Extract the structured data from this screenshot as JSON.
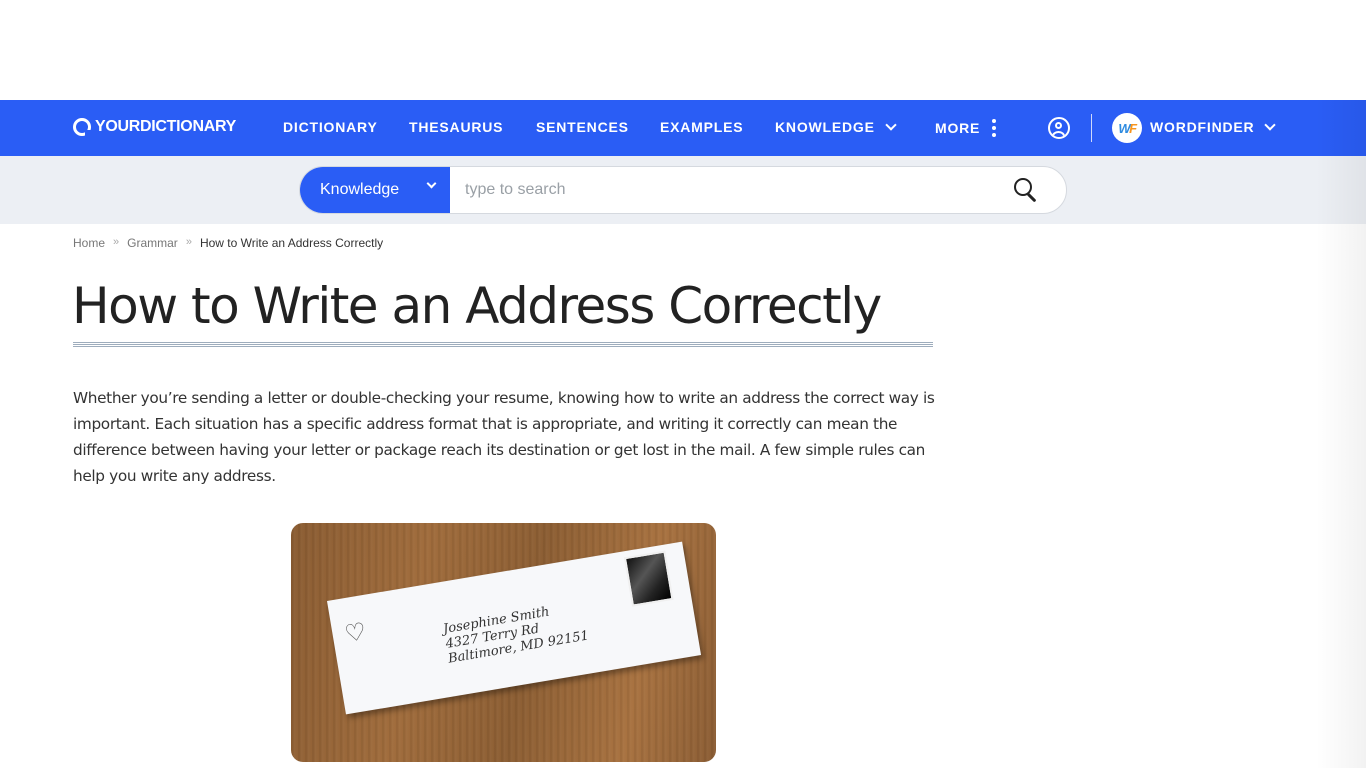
{
  "header": {
    "logo": "YOURDICTIONARY",
    "nav": [
      {
        "label": "DICTIONARY"
      },
      {
        "label": "THESAURUS"
      },
      {
        "label": "SENTENCES"
      },
      {
        "label": "EXAMPLES"
      },
      {
        "label": "KNOWLEDGE",
        "icon": "chevron-down-icon"
      },
      {
        "label": "MORE",
        "icon": "kebab-menu-icon"
      }
    ],
    "account_icon": "user-circle-icon",
    "wordfinder": {
      "badge_w": "W",
      "badge_f": "F",
      "label": "WORDFINDER"
    }
  },
  "search": {
    "category": "Knowledge",
    "placeholder": "type to search",
    "value": "",
    "button_icon": "search-icon"
  },
  "breadcrumb": [
    {
      "label": "Home"
    },
    {
      "label": "Grammar"
    },
    {
      "label": "How to Write an Address Correctly"
    }
  ],
  "breadcrumb_separator": "»",
  "article": {
    "title": "How to Write an Address Correctly",
    "intro": "Whether you’re sending a letter or double-checking your resume, knowing how to write an address the correct way is important. Each situation has a specific address format that is appropriate, and writing it correctly can mean the difference between having your letter or package reach its destination or get lost in the mail. A few simple rules can help you write any address.",
    "image": {
      "description": "Handwritten envelope on a wooden table",
      "heart": "♡",
      "address_lines": [
        "Josephine Smith",
        "4327 Terry Rd",
        "Baltimore, MD 92151"
      ]
    }
  },
  "colors": {
    "brand_blue": "#2a5df5",
    "search_band": "#eceff4",
    "text": "#333333"
  }
}
